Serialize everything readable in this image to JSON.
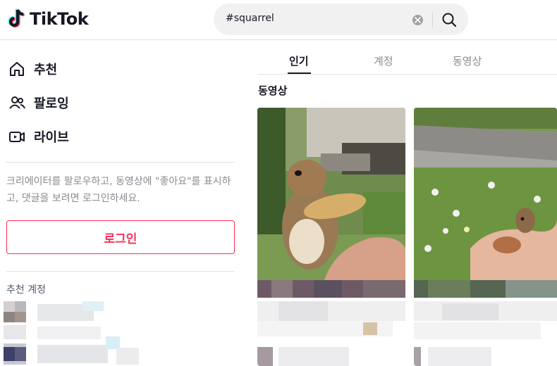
{
  "header": {
    "logo_text": "TikTok",
    "search": {
      "value": "#squarrel",
      "placeholder": ""
    }
  },
  "sidebar": {
    "nav": [
      {
        "label": "추천",
        "icon": "home-icon"
      },
      {
        "label": "팔로잉",
        "icon": "following-icon"
      },
      {
        "label": "라이브",
        "icon": "live-icon"
      }
    ],
    "login_hint": "크리에이터를 팔로우하고, 동영상에 \"좋아요\"를 표시하고, 댓글을 보려면 로그인하세요.",
    "login_button": "로그인",
    "suggested_title": "추천 계정"
  },
  "main": {
    "tabs": [
      {
        "label": "인기",
        "active": true
      },
      {
        "label": "계정",
        "active": false
      },
      {
        "label": "동영상",
        "active": false
      }
    ],
    "section_title": "동영상"
  },
  "colors": {
    "brand": "#fe2c55",
    "text": "#161823",
    "muted": "#8a8b91",
    "cyan": "#25f4ee"
  }
}
